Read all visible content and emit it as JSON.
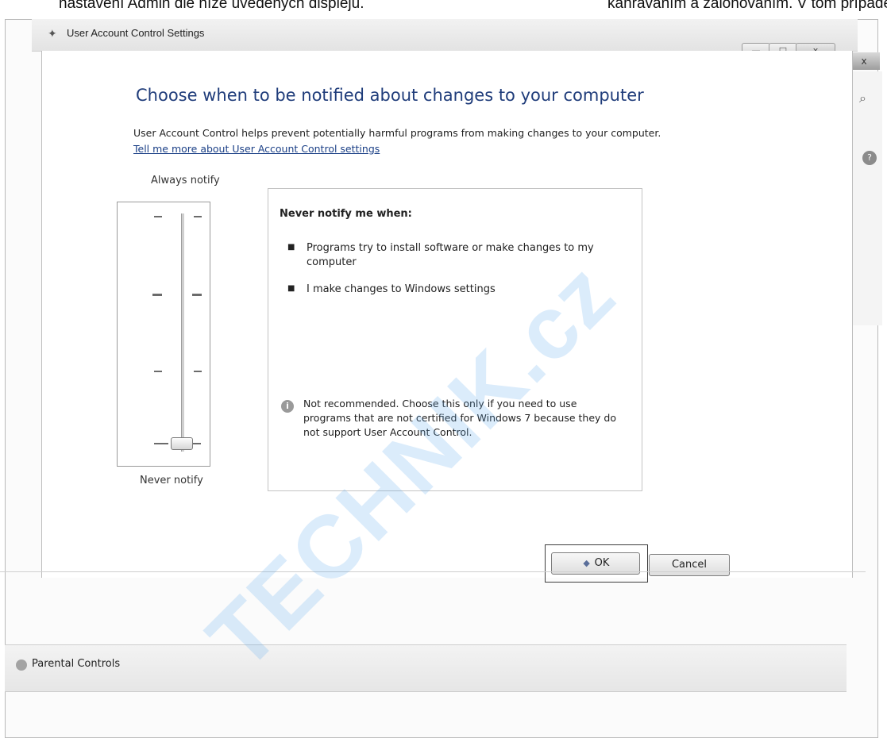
{
  "document": {
    "top_text_left": "nastavení Admin dle níže uvedených displejů.",
    "top_text_right": "kanrávaním a zálohováním. V tom případě pro"
  },
  "window": {
    "title": "User Account Control Settings",
    "controls": {
      "minimize": "—",
      "maximize": "□",
      "close": "x"
    }
  },
  "main": {
    "heading": "Choose when to be notified about changes to your computer",
    "description": "User Account Control helps prevent potentially harmful programs from making changes to your computer.",
    "link": "Tell me more about User Account Control settings"
  },
  "slider": {
    "top_label": "Always notify",
    "bottom_label": "Never notify",
    "level": 0,
    "levels": 4
  },
  "info": {
    "title": "Never notify me when:",
    "bullets": [
      "Programs try to install software or make changes to my computer",
      "I make changes to Windows settings"
    ],
    "warning": "Not recommended. Choose this only if you need to use programs that are not certified for Windows 7 because they do not support User Account Control."
  },
  "buttons": {
    "ok": "OK",
    "cancel": "Cancel"
  },
  "footer": {
    "label": "Parental Controls"
  },
  "watermark": "TECHNIK.cz"
}
